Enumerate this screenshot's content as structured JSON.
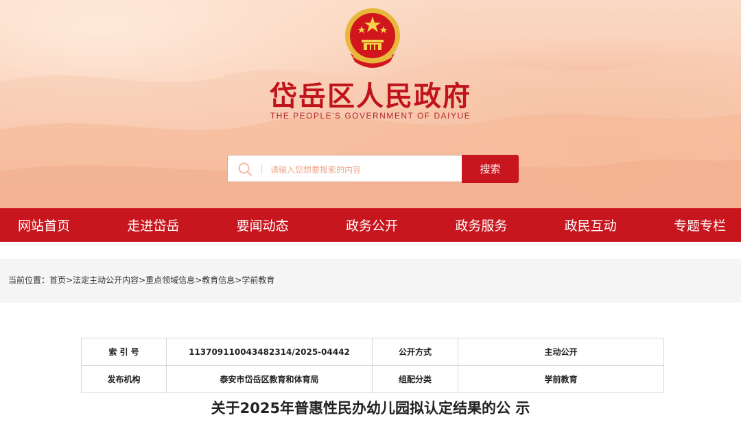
{
  "header": {
    "title": "岱岳区人民政府",
    "subtitle": "THE PEOPLE'S GOVERNMENT OF DAIYUE",
    "emblem_icon": "national-emblem-icon"
  },
  "search": {
    "placeholder": "请输入您想要搜索的内容",
    "button_label": "搜索"
  },
  "nav": {
    "items": [
      "网站首页",
      "走进岱岳",
      "要闻动态",
      "政务公开",
      "政务服务",
      "政民互动",
      "专题专栏"
    ]
  },
  "breadcrumb": {
    "prefix": "当前位置：",
    "items": [
      "首页",
      "法定主动公开内容",
      "重点领域信息",
      "教育信息",
      "学前教育"
    ],
    "separator": ">"
  },
  "info": {
    "index_label": "索 引 号",
    "index_value": "113709110043482314/2025-04442",
    "method_label": "公开方式",
    "method_value": "主动公开",
    "org_label": "发布机构",
    "org_value": "泰安市岱岳区教育和体育局",
    "category_label": "组配分类",
    "category_value": "学前教育"
  },
  "document": {
    "title": "关于2025年普惠性民办幼儿园拟认定结果的公 示"
  },
  "colors": {
    "primary_red": "#c8161e",
    "title_red": "#c0141c",
    "banner_peach": "#f7c4a8",
    "crumb_bg": "#f5f5f5"
  }
}
